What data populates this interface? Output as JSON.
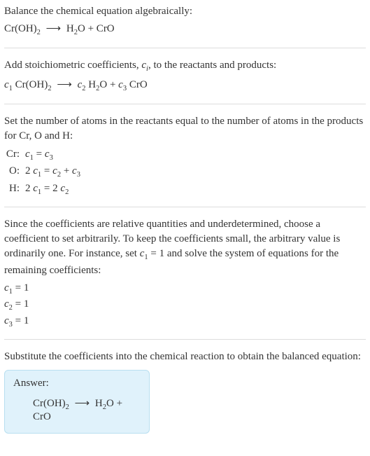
{
  "s1": {
    "line1": "Balance the chemical equation algebraically:",
    "eq_lhs": "Cr(OH)",
    "eq_sub1": "2",
    "eq_arrow": "⟶",
    "eq_rhs1": "H",
    "eq_sub2": "2",
    "eq_rhs2": "O + CrO"
  },
  "s2": {
    "line1a": "Add stoichiometric coefficients, ",
    "c": "c",
    "i": "i",
    "line1b": ", to the reactants and products:",
    "c1": "c",
    "c1s": "1",
    "p1": " Cr(OH)",
    "p1s": "2",
    "arrow": "⟶",
    "c2": "c",
    "c2s": "2",
    "p2": " H",
    "p2s": "2",
    "p2o": "O + ",
    "c3": "c",
    "c3s": "3",
    "p3": " CrO"
  },
  "s3": {
    "line1": "Set the number of atoms in the reactants equal to the number of atoms in the products for Cr, O and H:",
    "rows": [
      {
        "label": "Cr:",
        "c1": "c",
        "c1s": "1",
        "eq": " = ",
        "c2": "c",
        "c2s": "3"
      },
      {
        "label": "O:",
        "pre": "2 ",
        "c1": "c",
        "c1s": "1",
        "eq": " = ",
        "c2": "c",
        "c2s": "2",
        "plus": " + ",
        "c3": "c",
        "c3s": "3"
      },
      {
        "label": "H:",
        "pre": "2 ",
        "c1": "c",
        "c1s": "1",
        "eq": " = 2 ",
        "c2": "c",
        "c2s": "2"
      }
    ]
  },
  "s4": {
    "line1a": "Since the coefficients are relative quantities and underdetermined, choose a coefficient to set arbitrarily. To keep the coefficients small, the arbitrary value is ordinarily one. For instance, set ",
    "c1": "c",
    "c1s": "1",
    "line1b": " = 1 and solve the system of equations for the remaining coefficients:",
    "coefs": [
      {
        "c": "c",
        "s": "1",
        "v": " = 1"
      },
      {
        "c": "c",
        "s": "2",
        "v": " = 1"
      },
      {
        "c": "c",
        "s": "3",
        "v": " = 1"
      }
    ]
  },
  "s5": {
    "line1": "Substitute the coefficients into the chemical reaction to obtain the balanced equation:",
    "answer_label": "Answer:",
    "eq_lhs": "Cr(OH)",
    "eq_sub1": "2",
    "eq_arrow": "⟶",
    "eq_rhs1": "H",
    "eq_sub2": "2",
    "eq_rhs2": "O + CrO"
  }
}
